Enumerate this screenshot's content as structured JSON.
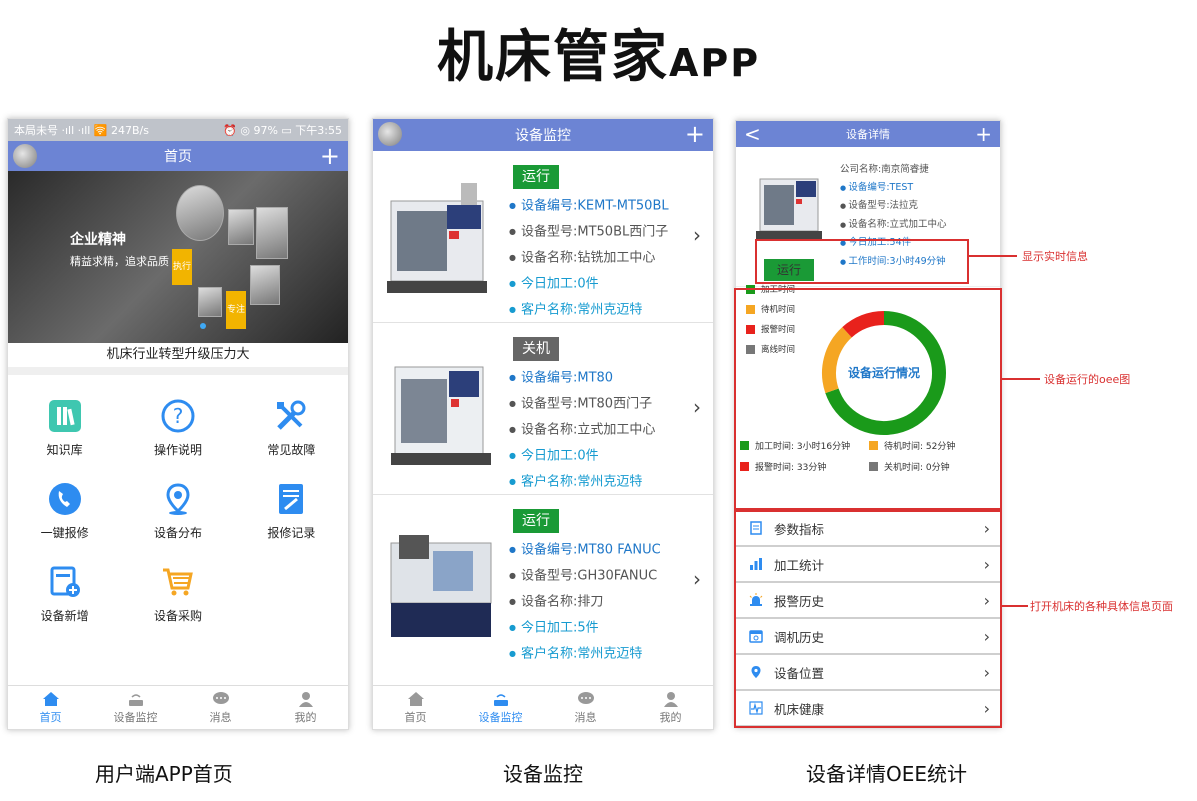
{
  "page": {
    "title_main": "机床管家",
    "title_suffix": "APP",
    "captions": [
      "用户端APP首页",
      "设备监控",
      "设备详情OEE统计"
    ]
  },
  "colors": {
    "accent_blue": "#6c84d4",
    "run_green": "#1a9a36",
    "off_gray": "#666666",
    "link_blue": "#1f77c8",
    "annotation_red": "#d93030"
  },
  "phone1": {
    "status_left": "本局未号 ·ıll ·ıll 🛜 247B/s",
    "status_right": "⏰ ◎ 97% ▭ 下午3:55",
    "title": "首页",
    "plus": "+",
    "banner_line1": "企业精神",
    "banner_line2": "精益求精，追求品质",
    "banner_tag1": "执行",
    "banner_tag2": "专注",
    "headline": "机床行业转型升级压力大",
    "grid": [
      {
        "label": "知识库",
        "icon": "knowledge-icon"
      },
      {
        "label": "操作说明",
        "icon": "question-icon"
      },
      {
        "label": "常见故障",
        "icon": "wrench-icon"
      },
      {
        "label": "一键报修",
        "icon": "phone-icon"
      },
      {
        "label": "设备分布",
        "icon": "location-icon"
      },
      {
        "label": "报修记录",
        "icon": "record-icon"
      },
      {
        "label": "设备新增",
        "icon": "add-device-icon"
      },
      {
        "label": "设备采购",
        "icon": "cart-icon"
      }
    ],
    "tabs": [
      "首页",
      "设备监控",
      "消息",
      "我的"
    ]
  },
  "phone2": {
    "title": "设备监控",
    "plus": "+",
    "devices": [
      {
        "state": "运行",
        "code": "设备编号:KEMT-MT50BL",
        "model": "设备型号:MT50BL西门子",
        "name": "设备名称:钻铣加工中心",
        "today": "今日加工:0件",
        "customer": "客户名称:常州克迈特"
      },
      {
        "state": "关机",
        "code": "设备编号:MT80",
        "model": "设备型号:MT80西门子",
        "name": "设备名称:立式加工中心",
        "today": "今日加工:0件",
        "customer": "客户名称:常州克迈特"
      },
      {
        "state": "运行",
        "code": "设备编号:MT80 FANUC",
        "model": "设备型号:GH30FANUC",
        "name": "设备名称:排刀",
        "today": "今日加工:5件",
        "customer": "客户名称:常州克迈特"
      }
    ],
    "tabs": [
      "首页",
      "设备监控",
      "消息",
      "我的"
    ]
  },
  "phone3": {
    "title": "设备详情",
    "back": "<",
    "plus": "+",
    "company": "公司名称:南京简睿捷",
    "code": "设备编号:TEST",
    "model": "设备型号:法拉克",
    "name": "设备名称:立式加工中心",
    "today": "今日加工:54件",
    "worktime": "工作时间:3小时49分钟",
    "state": "运行",
    "legend": [
      "加工时间",
      "待机时间",
      "报警时间",
      "离线时间"
    ],
    "donut_label": "设备运行情况",
    "stats": [
      "加工时间: 3小时16分钟",
      "待机时间: 52分钟",
      "报警时间: 33分钟",
      "关机时间: 0分钟"
    ],
    "menu": [
      "参数指标",
      "加工统计",
      "报警历史",
      "调机历史",
      "设备位置",
      "机床健康"
    ]
  },
  "annotations": [
    "显示实时信息",
    "设备运行的oee图",
    "打开机床的各种具体信息页面"
  ],
  "chart_data": {
    "type": "pie",
    "title": "设备运行情况",
    "categories": [
      "加工时间",
      "待机时间",
      "报警时间",
      "关机时间"
    ],
    "values": [
      196,
      52,
      33,
      0
    ],
    "units": "分钟",
    "colors": [
      "#1a9a1a",
      "#f5a623",
      "#e8221c",
      "#777777"
    ],
    "legend_position": "top-left"
  }
}
